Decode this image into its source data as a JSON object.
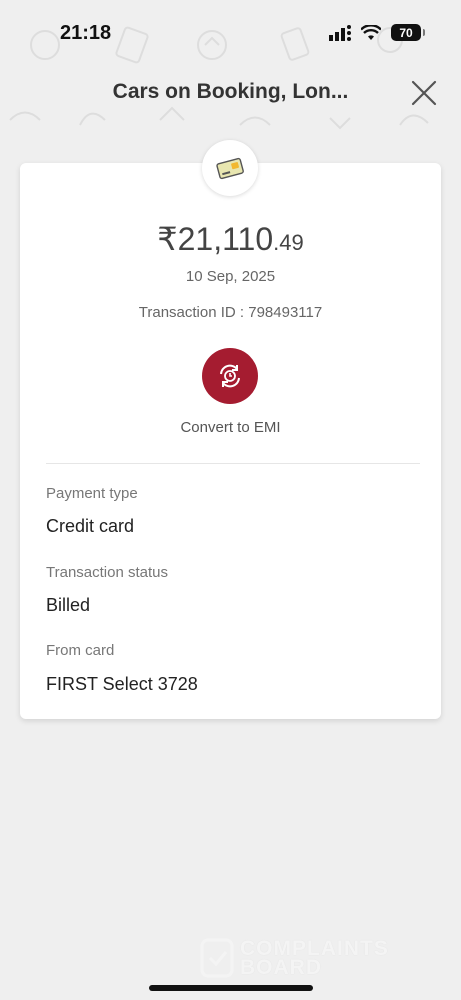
{
  "status_bar": {
    "time": "21:18",
    "battery_level": "70",
    "icons": [
      "signal-icon",
      "wifi-icon",
      "battery-icon"
    ]
  },
  "header": {
    "title": "Cars on Booking, Lon...",
    "close_icon": "close-icon"
  },
  "transaction": {
    "card_icon": "credit-card-icon",
    "amount_main": "₹21,110",
    "amount_fraction": ".49",
    "date": "10 Sep, 2025",
    "transaction_id": "Transaction ID : 798493117",
    "emi_icon": "convert-emi-icon",
    "emi_label": "Convert to EMI",
    "accent_color": "#a51c30"
  },
  "details": [
    {
      "label": "Payment type",
      "value": "Credit card"
    },
    {
      "label": "Transaction status",
      "value": "Billed"
    },
    {
      "label": "From card",
      "value": "FIRST Select 3728"
    }
  ],
  "watermark": {
    "line1": "COMPLAINTS",
    "line2": "BOARD"
  }
}
